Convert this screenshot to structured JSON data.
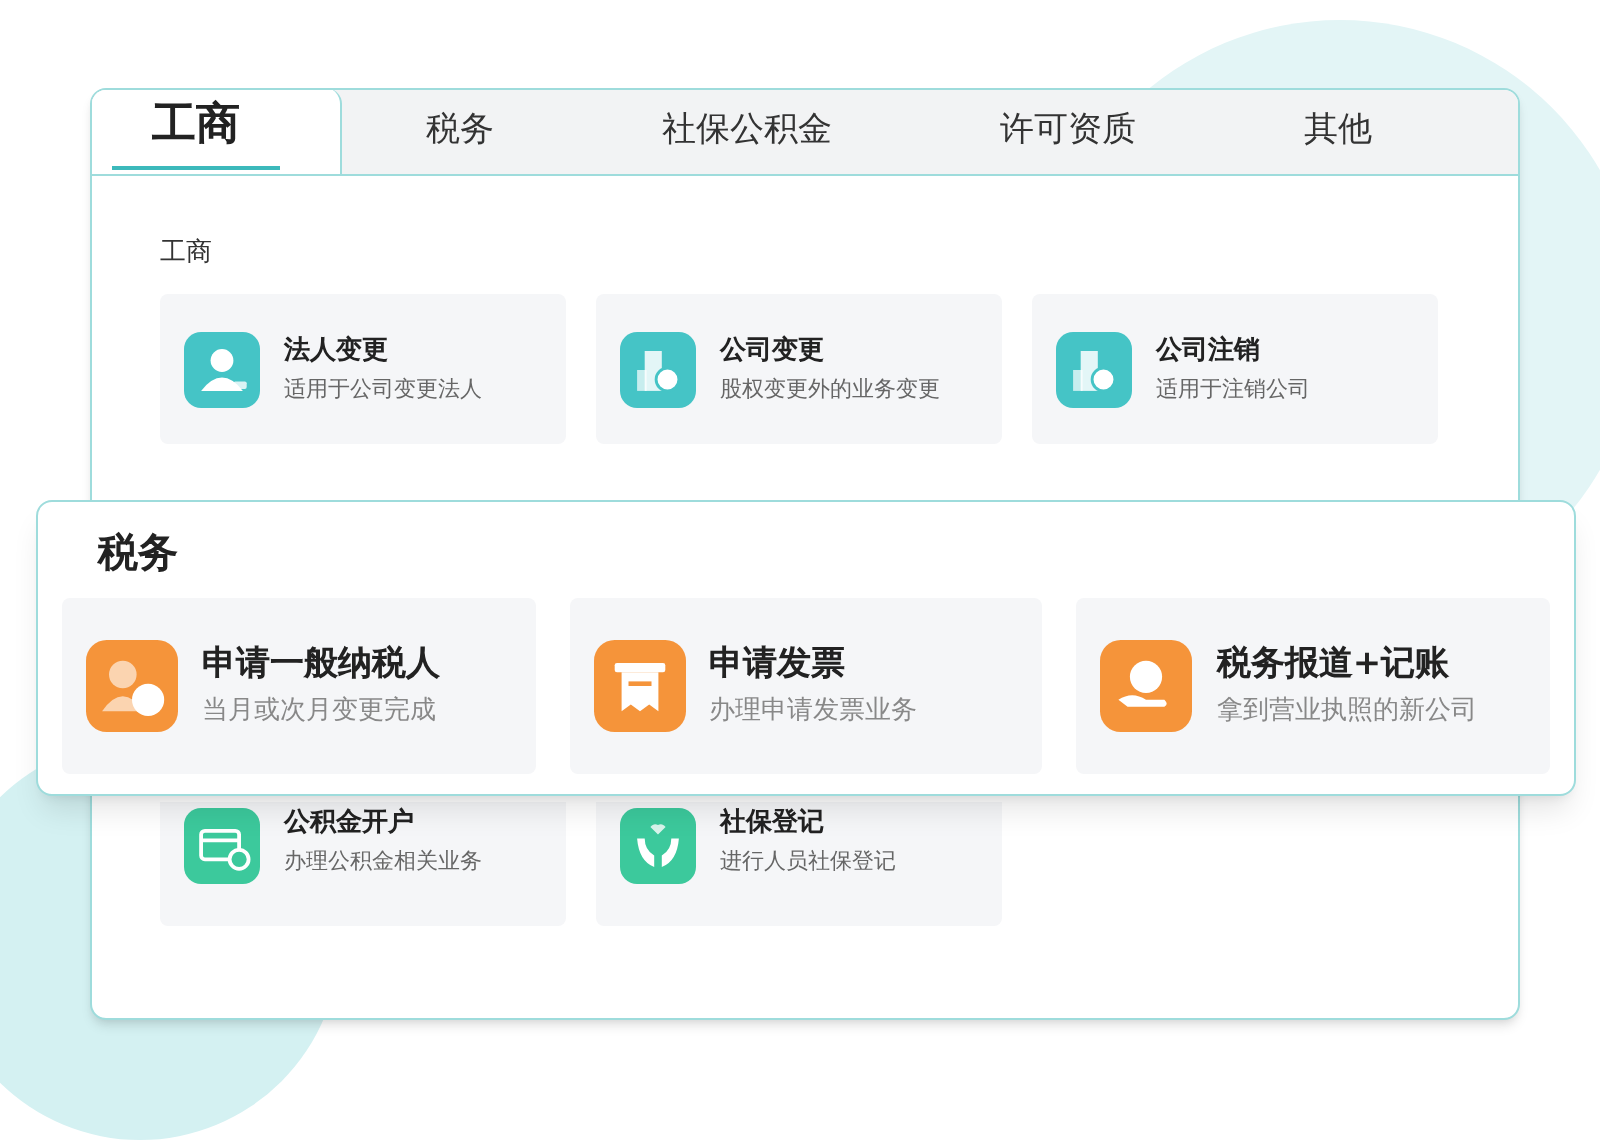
{
  "tabs": [
    {
      "label": "工商",
      "selected": true
    },
    {
      "label": "税务",
      "selected": false
    },
    {
      "label": "社保公积金",
      "selected": false
    },
    {
      "label": "许可资质",
      "selected": false
    },
    {
      "label": "其他",
      "selected": false
    }
  ],
  "sections": [
    {
      "heading": "工商",
      "color": "#45c4c6",
      "items": [
        {
          "kind": "person",
          "title": "法人变更",
          "subtitle": "适用于公司变更法人"
        },
        {
          "kind": "building",
          "title": "公司变更",
          "subtitle": "股权变更外的业务变更"
        },
        {
          "kind": "power",
          "title": "公司注销",
          "subtitle": "适用于注销公司"
        }
      ]
    },
    {
      "color": "#3cc99c",
      "items": [
        {
          "kind": "card",
          "title": "公积金开户",
          "subtitle": "办理公积金相关业务"
        },
        {
          "kind": "hands",
          "title": "社保登记",
          "subtitle": "进行人员社保登记"
        }
      ]
    }
  ],
  "popout": {
    "heading": "税务",
    "color": "#f5943a",
    "items": [
      {
        "kind": "badge",
        "title": "申请一般纳税人",
        "subtitle": "当月或次月变更完成"
      },
      {
        "kind": "receipt",
        "title": "申请发票",
        "subtitle": "办理申请发票业务"
      },
      {
        "kind": "coinhand",
        "title": "税务报道+记账",
        "subtitle": "拿到营业执照的新公司"
      }
    ]
  }
}
